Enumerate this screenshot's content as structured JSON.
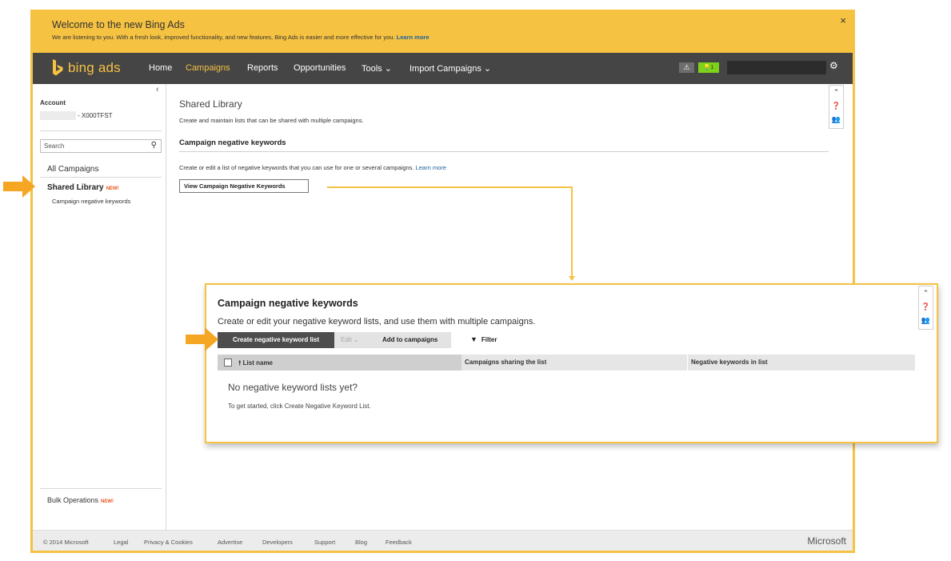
{
  "banner": {
    "title": "Welcome to the new Bing Ads",
    "description": "We are listening to you. With a fresh look, improved functionality, and new features, Bing Ads is easier and more effective for you.",
    "learn_more": "Learn more",
    "close": "×"
  },
  "nav": {
    "logo_text": "bing ads",
    "items": [
      {
        "label": "Home"
      },
      {
        "label": "Campaigns"
      },
      {
        "label": "Reports"
      },
      {
        "label": "Opportunities"
      },
      {
        "label": "Tools ⌄"
      },
      {
        "label": "Import Campaigns ⌄"
      }
    ],
    "alert_count": "1",
    "colors": {
      "accent": "#f5c242",
      "bar": "#454545"
    }
  },
  "sidebar": {
    "account_label": "Account",
    "account_id": "- X000TFST",
    "search_placeholder": "Search",
    "all_campaigns": "All Campaigns",
    "shared_library": "Shared Library",
    "new_badge": "NEW!",
    "negative_keywords": "Campaign negative keywords",
    "bulk_operations": "Bulk Operations"
  },
  "main": {
    "title": "Shared Library",
    "description": "Create and maintain lists that can be shared with multiple campaigns.",
    "section_title": "Campaign negative keywords",
    "section_desc": "Create or edit a list of negative keywords that you can use for one or several campaigns.",
    "learn_more": "Learn more",
    "view_button": "View Campaign Negative Keywords"
  },
  "callout": {
    "title": "Campaign negative keywords",
    "description": "Create or edit your negative keyword lists, and use them with multiple campaigns.",
    "create_button": "Create negative keyword list",
    "edit_button": "Edit ⌄",
    "add_button": "Add to campaigns",
    "filter_button": "Filter",
    "columns": [
      "List name",
      "Campaigns sharing the list",
      "Negative keywords in list"
    ],
    "empty_title": "No negative keyword lists yet?",
    "empty_hint": "To get started, click Create Negative Keyword List."
  },
  "footer": {
    "copyright": "© 2014 Microsoft",
    "links": [
      "Legal",
      "Privacy & Cookies",
      "Advertise",
      "Developers",
      "Support",
      "Blog",
      "Feedback"
    ],
    "brand": "Microsoft"
  }
}
